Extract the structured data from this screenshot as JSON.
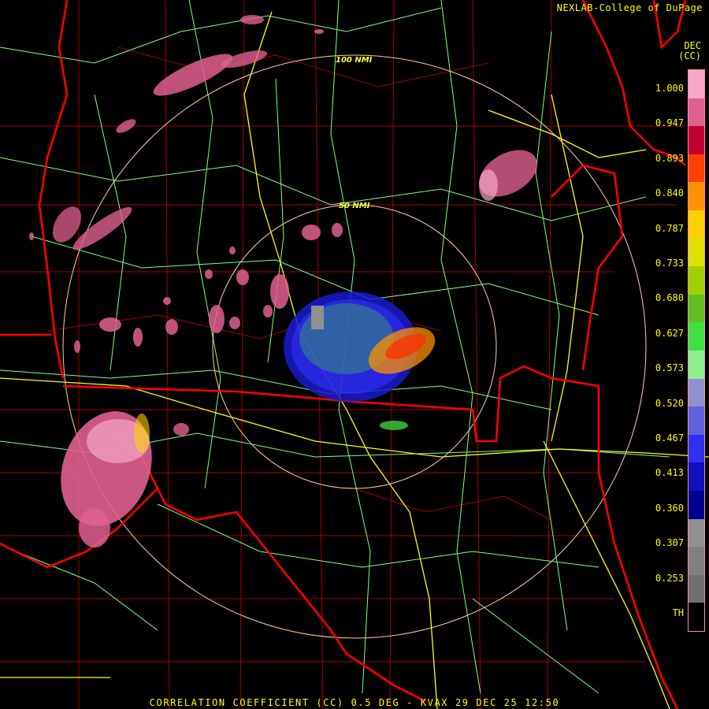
{
  "credit": "NEXLAB-College of DuPage",
  "units_top": "DEC",
  "units_bottom": "(CC)",
  "footer": "CORRELATION COEFFICIENT (CC) 0.5 DEG - KVAX 29 DEC 25 12:50",
  "rings": [
    {
      "label": "50 NMI"
    },
    {
      "label": "100 NMI"
    }
  ],
  "scale": {
    "labels": [
      "1.000",
      "0.947",
      "0.893",
      "0.840",
      "0.787",
      "0.733",
      "0.680",
      "0.627",
      "0.573",
      "0.520",
      "0.467",
      "0.413",
      "0.360",
      "0.307",
      "0.253",
      "TH"
    ],
    "colors": [
      "#f7a7c7",
      "#e06090",
      "#c00030",
      "#ff4000",
      "#ff9000",
      "#ffd000",
      "#e0e000",
      "#a0d000",
      "#60c020",
      "#40e040",
      "#90f090",
      "#9090d0",
      "#6060e0",
      "#3030f0",
      "#1010c0",
      "#000090",
      "#909090",
      "#808080",
      "#707070",
      "#000000"
    ]
  },
  "colors": {
    "state_border": "#ff0000",
    "county_border": "#a00000",
    "highway": "#80ff80",
    "interstate": "#ffff00",
    "ring": "#ffcfa0"
  }
}
